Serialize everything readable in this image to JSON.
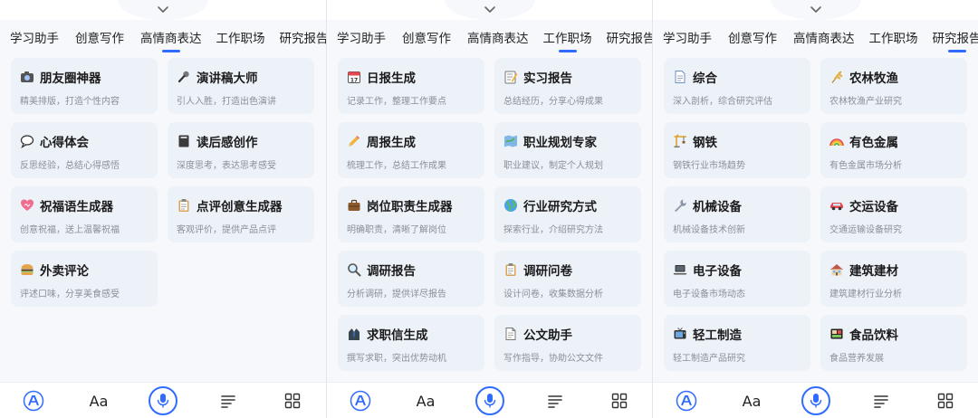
{
  "panels": [
    {
      "tabs": [
        "学习助手",
        "创意写作",
        "高情商表达",
        "工作职场",
        "研究报告"
      ],
      "active_tab": 2,
      "cards": [
        {
          "icon": "camera-icon",
          "title": "朋友圈神器",
          "subtitle": "精美排版，打造个性内容"
        },
        {
          "icon": "microphone-icon",
          "title": "演讲稿大师",
          "subtitle": "引人入胜，打造出色演讲"
        },
        {
          "icon": "speech-bubble-icon",
          "title": "心得体会",
          "subtitle": "反思经验，总结心得感悟"
        },
        {
          "icon": "notebook-icon",
          "title": "读后感创作",
          "subtitle": "深度思考，表达思考感受"
        },
        {
          "icon": "heart-icon",
          "title": "祝福语生成器",
          "subtitle": "创意祝福，送上温馨祝福"
        },
        {
          "icon": "clipboard-icon",
          "title": "点评创意生成器",
          "subtitle": "客观评价，提供产品点评"
        },
        {
          "icon": "burger-icon",
          "title": "外卖评论",
          "subtitle": "评述口味，分享美食感受"
        }
      ]
    },
    {
      "tabs": [
        "学习助手",
        "创意写作",
        "高情商表达",
        "工作职场",
        "研究报告"
      ],
      "active_tab": 3,
      "cards": [
        {
          "icon": "calendar-icon",
          "title": "日报生成",
          "subtitle": "记录工作，整理工作要点"
        },
        {
          "icon": "memo-icon",
          "title": "实习报告",
          "subtitle": "总结经历，分享心得成果"
        },
        {
          "icon": "pencil-icon",
          "title": "周报生成",
          "subtitle": "梳理工作，总结工作成果"
        },
        {
          "icon": "map-icon",
          "title": "职业规划专家",
          "subtitle": "职业建议，制定个人规划"
        },
        {
          "icon": "briefcase-icon",
          "title": "岗位职责生成器",
          "subtitle": "明确职责，清晰了解岗位"
        },
        {
          "icon": "globe-icon",
          "title": "行业研究方式",
          "subtitle": "探索行业，介绍研究方法"
        },
        {
          "icon": "magnifier-icon",
          "title": "调研报告",
          "subtitle": "分析调研，提供详尽报告"
        },
        {
          "icon": "clipboard-icon",
          "title": "调研问卷",
          "subtitle": "设计问卷，收集数据分析"
        },
        {
          "icon": "suit-icon",
          "title": "求职信生成",
          "subtitle": "撰写求职，突出优势动机"
        },
        {
          "icon": "document-icon",
          "title": "公文助手",
          "subtitle": "写作指导，协助公文文件"
        }
      ]
    },
    {
      "tabs": [
        "学习助手",
        "创意写作",
        "高情商表达",
        "工作职场",
        "研究报告"
      ],
      "active_tab": 4,
      "cards": [
        {
          "icon": "page-icon",
          "title": "综合",
          "subtitle": "深入剖析，综合研究评估"
        },
        {
          "icon": "wheat-icon",
          "title": "农林牧渔",
          "subtitle": "农林牧渔产业研究"
        },
        {
          "icon": "crane-icon",
          "title": "钢铁",
          "subtitle": "钢铁行业市场趋势"
        },
        {
          "icon": "rainbow-icon",
          "title": "有色金属",
          "subtitle": "有色金属市场分析"
        },
        {
          "icon": "wrench-icon",
          "title": "机械设备",
          "subtitle": "机械设备技术创新"
        },
        {
          "icon": "car-icon",
          "title": "交运设备",
          "subtitle": "交通运输设备研究"
        },
        {
          "icon": "laptop-icon",
          "title": "电子设备",
          "subtitle": "电子设备市场动态"
        },
        {
          "icon": "house-icon",
          "title": "建筑建材",
          "subtitle": "建筑建材行业分析"
        },
        {
          "icon": "tv-icon",
          "title": "轻工制造",
          "subtitle": "轻工制造产品研究"
        },
        {
          "icon": "bento-icon",
          "title": "食品饮料",
          "subtitle": "食品营养发展"
        }
      ]
    }
  ],
  "bottom_bar": {
    "font_label": "Aa",
    "icons": [
      "app-logo-icon",
      "font-icon",
      "microphone-icon",
      "text-lines-icon",
      "grid-icon"
    ]
  },
  "colors": {
    "accent": "#2f6bff",
    "card_bg": "#edf2f8",
    "subtitle": "#8a8f98"
  }
}
